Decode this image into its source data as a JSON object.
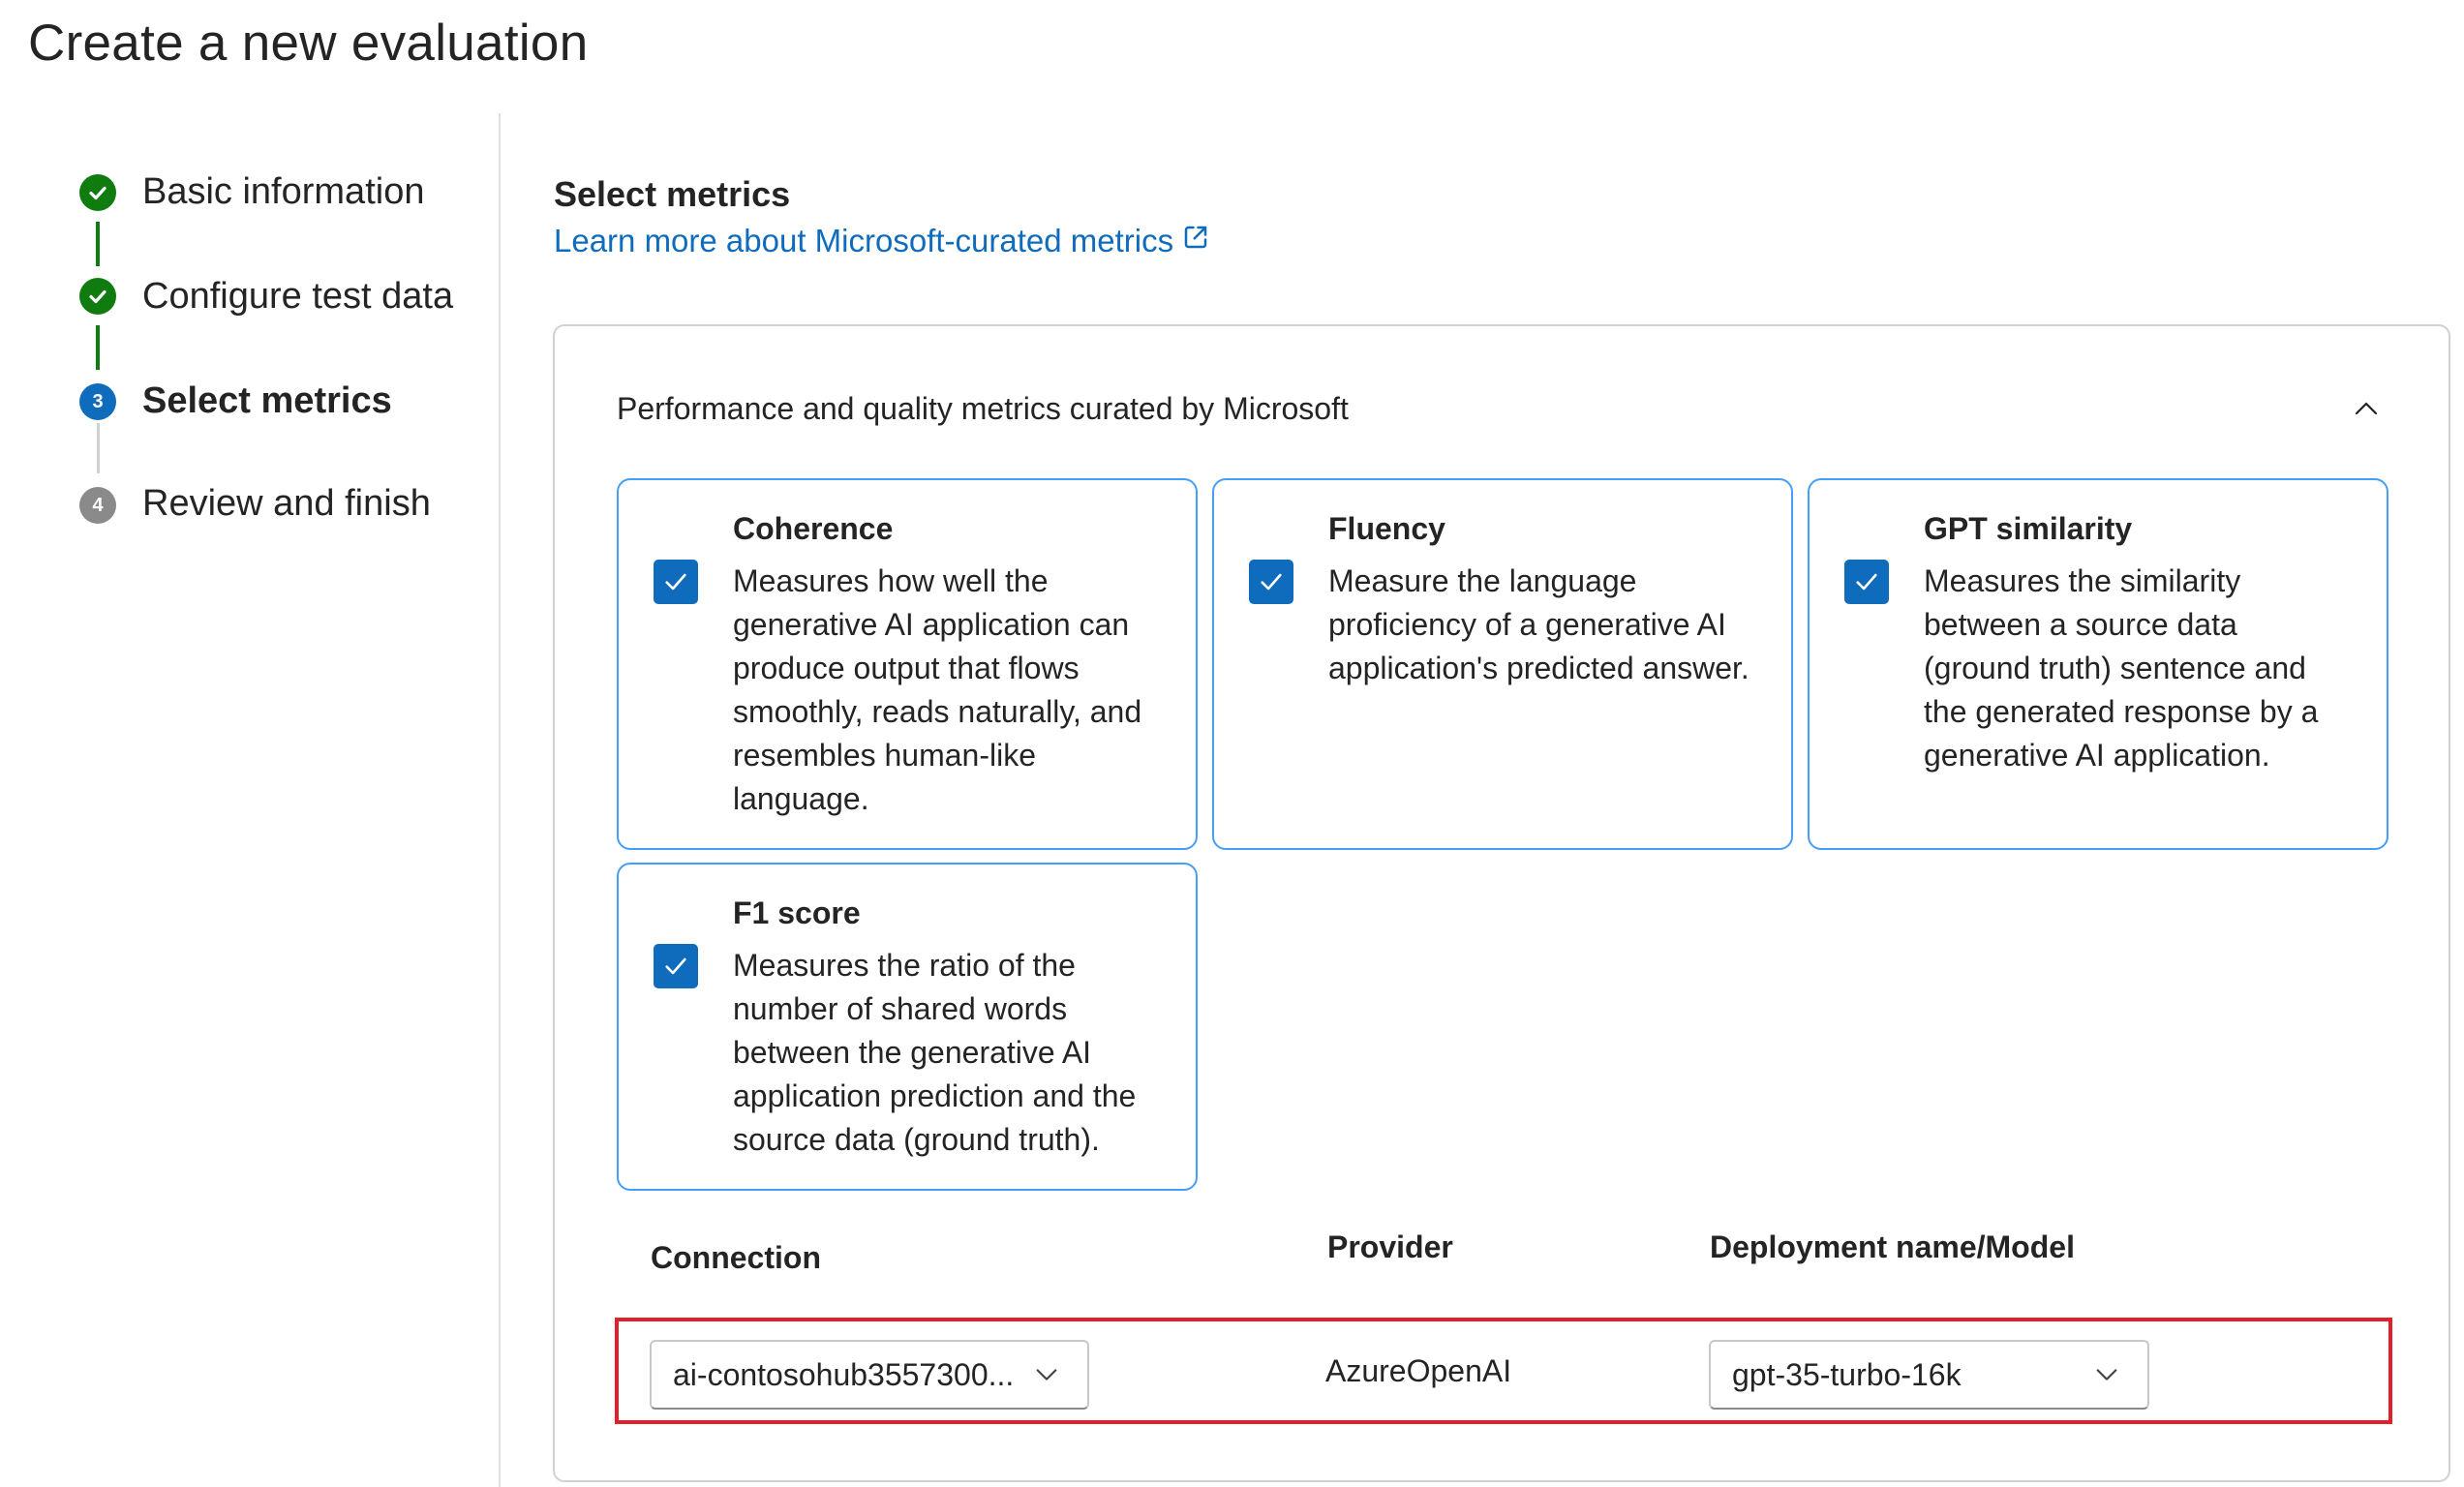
{
  "page": {
    "title": "Create a new evaluation"
  },
  "steps": [
    {
      "label": "Basic information",
      "status": "done"
    },
    {
      "label": "Configure test data",
      "status": "done"
    },
    {
      "label": "Select metrics",
      "status": "current",
      "number": "3"
    },
    {
      "label": "Review and finish",
      "status": "todo",
      "number": "4"
    }
  ],
  "main": {
    "section_title": "Select metrics",
    "learn_link": "Learn more about Microsoft-curated metrics",
    "panel_title": "Performance and quality metrics curated by Microsoft",
    "metrics": [
      {
        "title": "Coherence",
        "description": "Measures how well the generative AI application can produce output that flows smoothly, reads naturally, and resembles human-like language.",
        "checked": true
      },
      {
        "title": "Fluency",
        "description": "Measure the language proficiency of a generative AI application's predicted answer.",
        "checked": true
      },
      {
        "title": "GPT similarity",
        "description": "Measures the similarity between a source data (ground truth) sentence and the generated response by a generative AI application.",
        "checked": true
      },
      {
        "title": "F1 score",
        "description": "Measures the ratio of the number of shared words between the generative AI application prediction and the source data (ground truth).",
        "checked": true
      }
    ],
    "config": {
      "connection_label": "Connection",
      "provider_label": "Provider",
      "deployment_label": "Deployment name/Model",
      "connection_value": "ai-contosohub3557300...",
      "provider_value": "AzureOpenAI",
      "deployment_value": "gpt-35-turbo-16k"
    }
  },
  "colors": {
    "accent": "#0f6cbd",
    "success": "#107c10",
    "highlight": "#e0212b",
    "card_border": "#479ef5"
  }
}
